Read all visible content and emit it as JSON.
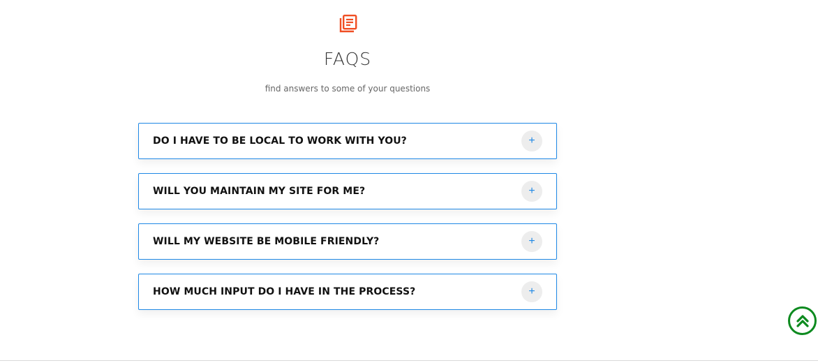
{
  "header": {
    "icon": "book-list-icon",
    "icon_color": "#f04e23",
    "title": "FAQS",
    "subtitle": "find answers to some of your questions"
  },
  "faqs": [
    {
      "question": "DO I HAVE TO BE LOCAL TO WORK WITH YOU?",
      "toggle": "+"
    },
    {
      "question": "WILL YOU MAINTAIN MY SITE FOR ME?",
      "toggle": "+"
    },
    {
      "question": "WILL MY WEBSITE BE MOBILE FRIENDLY?",
      "toggle": "+"
    },
    {
      "question": "HOW MUCH INPUT DO I HAVE IN THE PROCESS?",
      "toggle": "+"
    }
  ],
  "colors": {
    "accent": "#1e88e5",
    "scroll_top": "#0d8a1f"
  },
  "scroll_top": {
    "icon": "double-chevron-up-icon"
  }
}
